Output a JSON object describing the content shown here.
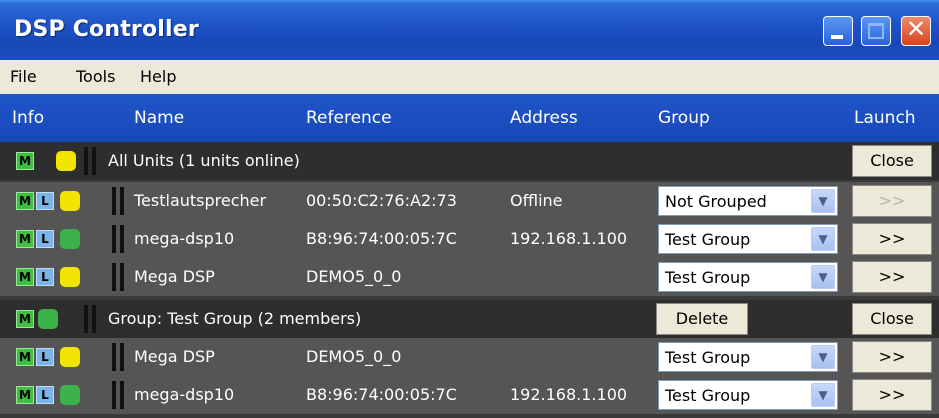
{
  "window": {
    "title": "DSP Controller",
    "close_glyph": "✕"
  },
  "menu": [
    "File",
    "Tools",
    "Help"
  ],
  "columns": {
    "info": "Info",
    "name": "Name",
    "reference": "Reference",
    "address": "Address",
    "group": "Group",
    "launch": "Launch"
  },
  "all_units": {
    "label": "All Units (1 units online)",
    "m_label": "M",
    "status_color": "yellow",
    "close_label": "Close"
  },
  "units": [
    {
      "m": "M",
      "l": "L",
      "status": "yellow",
      "name": "Testlautsprecher",
      "reference": "00:50:C2:76:A2:73",
      "address": "Offline",
      "group": "Not Grouped",
      "launch": ">>",
      "launch_enabled": false
    },
    {
      "m": "M",
      "l": "L",
      "status": "green",
      "name": "mega-dsp10",
      "reference": "B8:96:74:00:05:7C",
      "address": "192.168.1.100",
      "group": "Test Group",
      "launch": ">>",
      "launch_enabled": true
    },
    {
      "m": "M",
      "l": "L",
      "status": "yellow",
      "name": "Mega DSP",
      "reference": "DEMO5_0_0",
      "address": "",
      "group": "Test Group",
      "launch": ">>",
      "launch_enabled": true
    }
  ],
  "test_group": {
    "label": "Group: Test Group (2 members)",
    "m_label": "M",
    "status_color": "green",
    "delete_label": "Delete",
    "close_label": "Close"
  },
  "group_members": [
    {
      "m": "M",
      "l": "L",
      "status": "yellow",
      "name": "Mega DSP",
      "reference": "DEMO5_0_0",
      "address": "",
      "group": "Test Group",
      "launch": ">>",
      "launch_enabled": true
    },
    {
      "m": "M",
      "l": "L",
      "status": "green",
      "name": "mega-dsp10",
      "reference": "B8:96:74:00:05:7C",
      "address": "192.168.1.100",
      "group": "Test Group",
      "launch": ">>",
      "launch_enabled": true
    }
  ],
  "colors": {
    "title_blue": "#1f55c8",
    "menu_bg": "#ece9d8",
    "unit_row_bg": "#555555",
    "group_row_bg": "#2e2e2e",
    "status_yellow": "#f2e400",
    "status_green": "#3cb34a"
  }
}
